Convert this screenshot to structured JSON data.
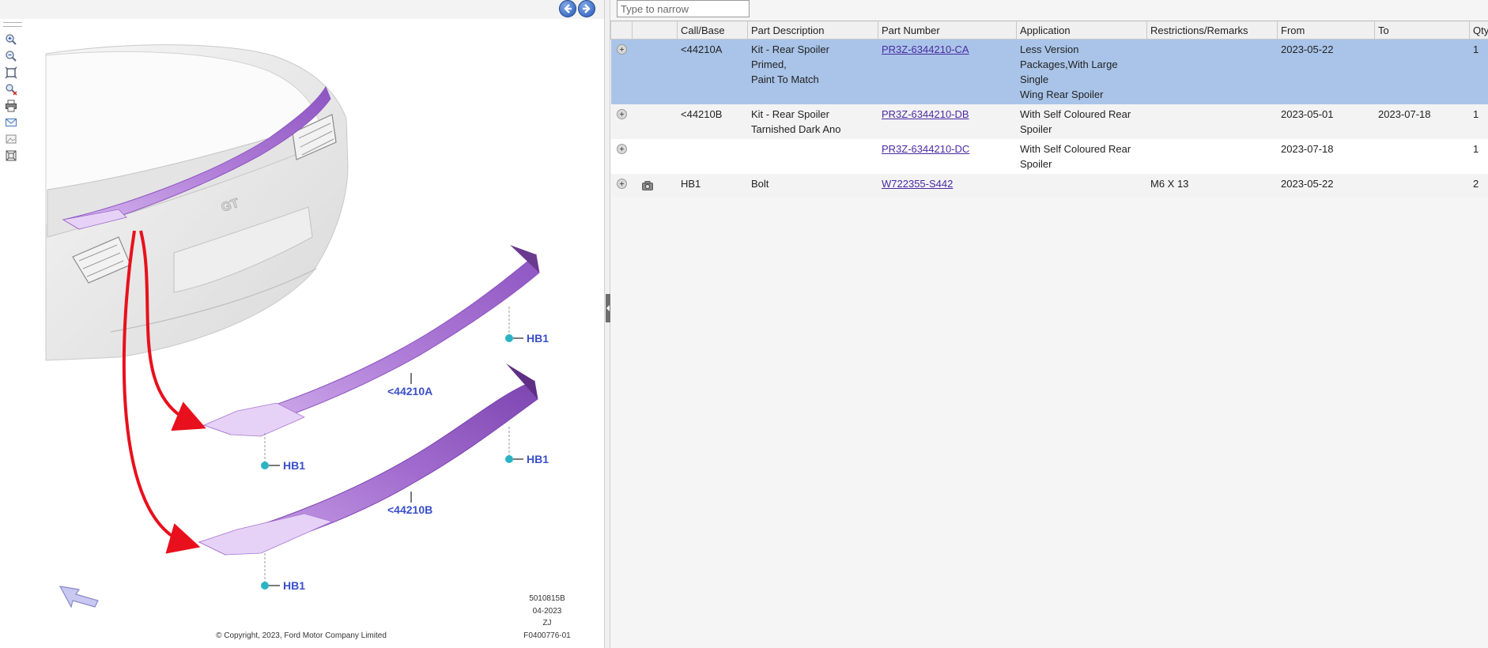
{
  "filter": {
    "placeholder": "Type to narrow"
  },
  "table": {
    "columns": [
      "",
      "",
      "Call/Base",
      "Part Description",
      "Part Number",
      "Application",
      "Restrictions/Remarks",
      "From",
      "To",
      "Qty"
    ],
    "rows": [
      {
        "call_base": "<44210A",
        "description": "Kit - Rear Spoiler\nPrimed,\nPaint To Match",
        "part_number": "PR3Z-6344210-CA",
        "application": "Less Version\nPackages,With Large Single\nWing Rear Spoiler",
        "remarks": "",
        "from": "2023-05-22",
        "to": "",
        "qty": "1",
        "selected": true,
        "has_photo": false
      },
      {
        "call_base": "<44210B",
        "description": "Kit - Rear Spoiler\nTarnished Dark Ano",
        "part_number": "PR3Z-6344210-DB",
        "application": "With Self Coloured Rear\nSpoiler",
        "remarks": "",
        "from": "2023-05-01",
        "to": "2023-07-18",
        "qty": "1",
        "selected": false,
        "has_photo": false
      },
      {
        "call_base": "",
        "description": "",
        "part_number": "PR3Z-6344210-DC",
        "application": "With Self Coloured Rear\nSpoiler",
        "remarks": "",
        "from": "2023-07-18",
        "to": "",
        "qty": "1",
        "selected": false,
        "has_photo": false
      },
      {
        "call_base": "HB1",
        "description": "Bolt",
        "part_number": "W722355-S442",
        "application": "",
        "remarks": "M6 X 13",
        "from": "2023-05-22",
        "to": "",
        "qty": "2",
        "selected": false,
        "has_photo": true
      }
    ]
  },
  "diagram": {
    "callouts": {
      "spoiler_a": "<44210A",
      "spoiler_b": "<44210B",
      "bolt": "HB1"
    },
    "stamp": {
      "line1": "5010815B",
      "line2": "04-2023",
      "line3": "ZJ",
      "line4": "F0400776-01"
    },
    "copyright": "© Copyright, 2023, Ford Motor Company Limited",
    "badge_text": "GT",
    "colors": {
      "spoiler": "#b07ed8",
      "spoiler_dark": "#8e55c2",
      "arrow": "#e8101c",
      "bolt": "#2bb3c4",
      "callout_text": "#3a4fc9"
    }
  },
  "toolbar": {
    "icons": [
      "zoom-in-icon",
      "zoom-out-icon",
      "fit-icon",
      "zoom-area-icon",
      "print-icon",
      "email-icon",
      "image-icon",
      "export-icon"
    ]
  }
}
